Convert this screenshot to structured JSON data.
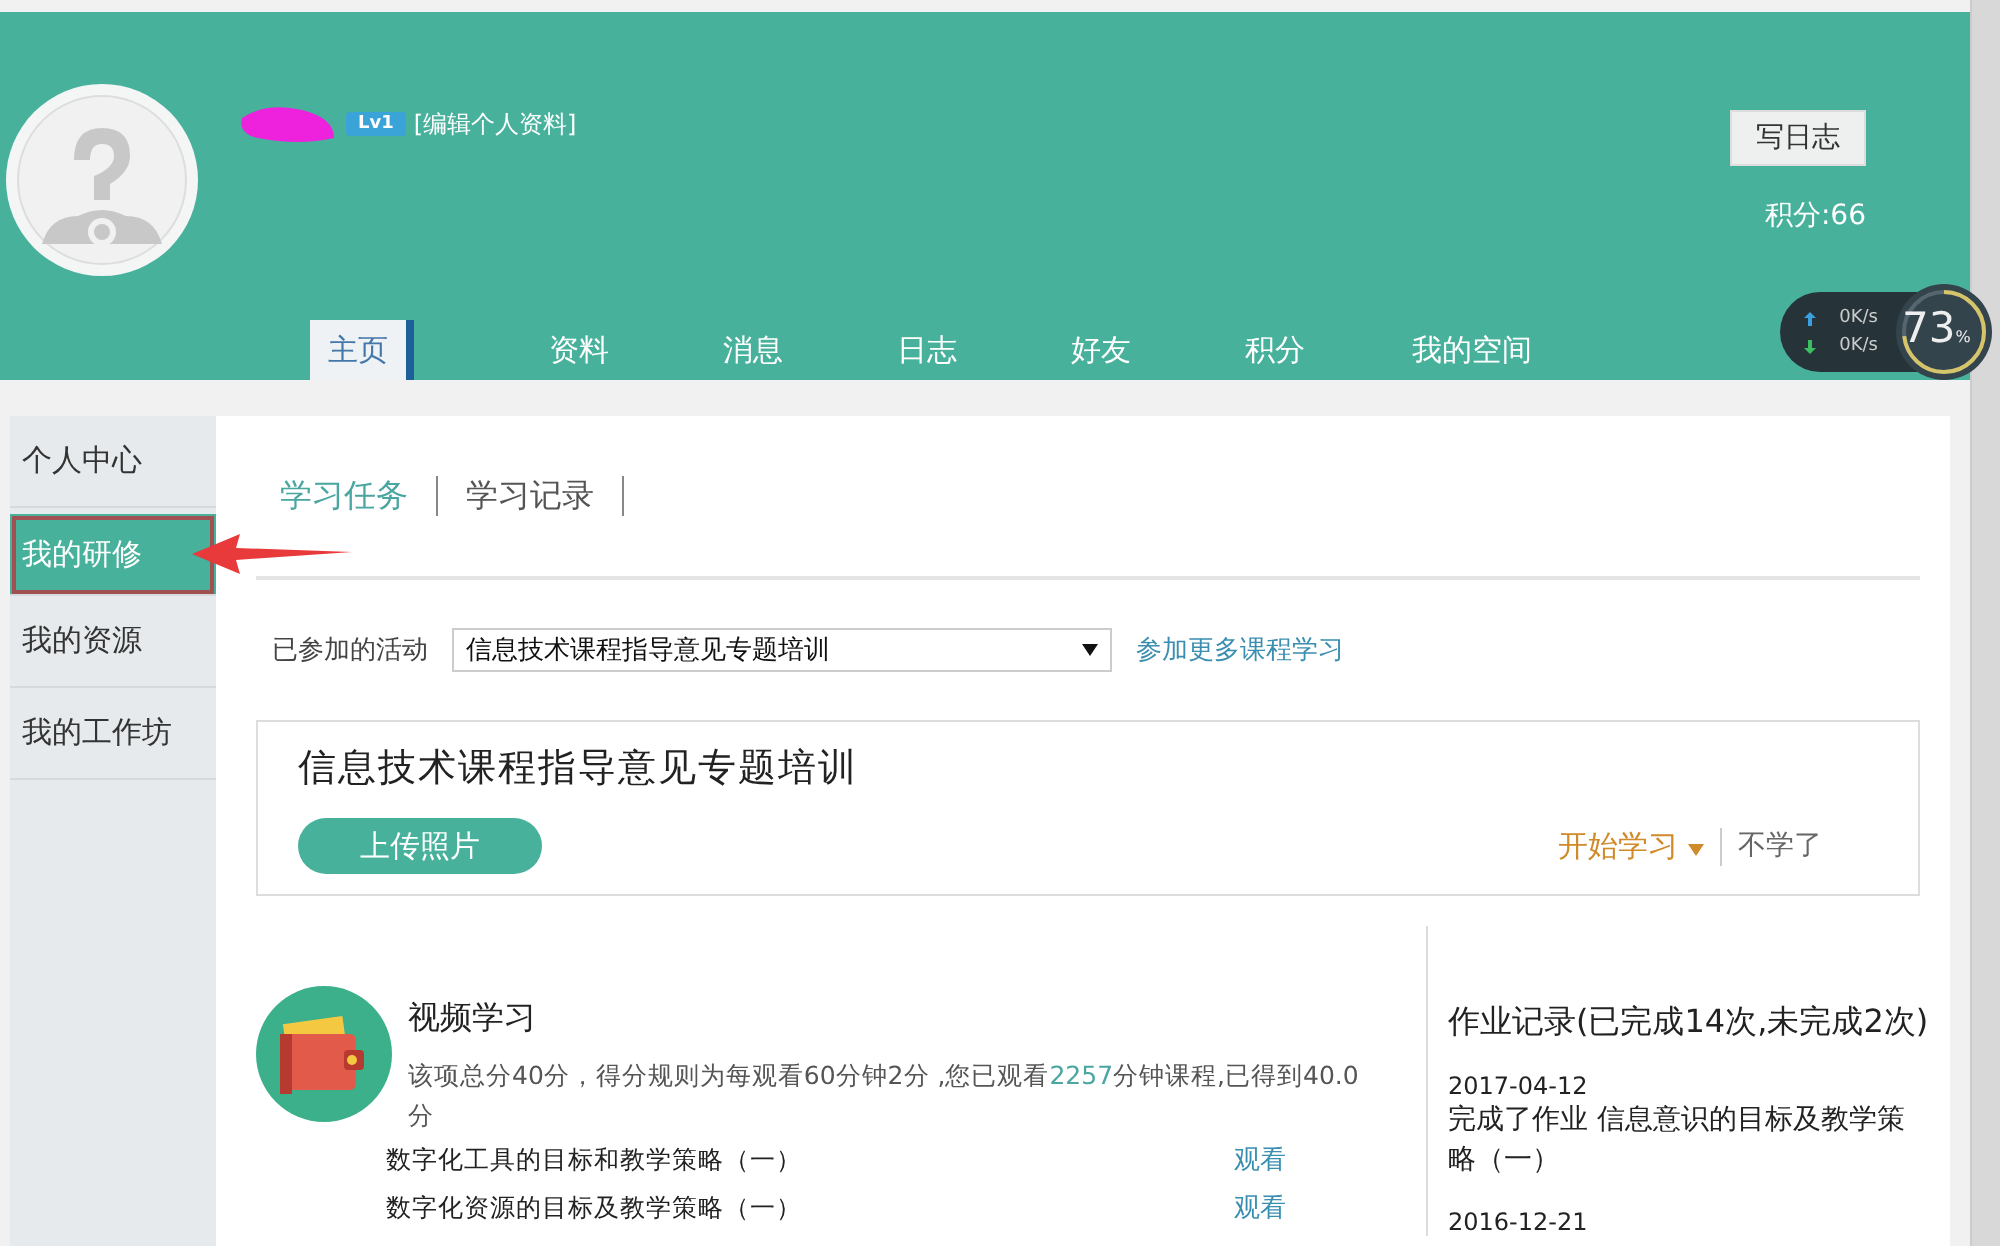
{
  "header": {
    "level_badge": "Lv1",
    "edit_link": "[编辑个人资料]",
    "write_button": "写日志",
    "points": "积分:66",
    "nav_tabs": [
      {
        "label": "主页",
        "selected": true
      },
      {
        "label": "资料",
        "selected": false
      },
      {
        "label": "消息",
        "selected": false
      },
      {
        "label": "日志",
        "selected": false
      },
      {
        "label": "好友",
        "selected": false
      },
      {
        "label": "积分",
        "selected": false
      },
      {
        "label": "我的空间",
        "selected": false
      }
    ]
  },
  "net_widget": {
    "upload": "0K/s",
    "download": "0K/s",
    "value": "73",
    "unit": "%"
  },
  "sidebar": {
    "items": [
      {
        "label": "个人中心",
        "selected": false
      },
      {
        "label": "我的研修",
        "selected": true
      },
      {
        "label": "我的资源",
        "selected": false
      },
      {
        "label": "我的工作坊",
        "selected": false
      }
    ]
  },
  "content_tabs": [
    {
      "label": "学习任务",
      "selected": true
    },
    {
      "label": "学习记录",
      "selected": false
    }
  ],
  "activity": {
    "label": "已参加的活动",
    "select_value": "信息技术课程指导意见专题培训",
    "link": "参加更多课程学习"
  },
  "course_card": {
    "title": "信息技术课程指导意见专题培训",
    "upload_button": "上传照片",
    "start_button": "开始学习",
    "quit_link": "不学了"
  },
  "video_study": {
    "title": "视频学习",
    "description": [
      "该项总分40分，得分规则为每观看60分钟2分 ,您已观看",
      "2257",
      "分钟课程,已得到40.0分"
    ],
    "lessons": [
      {
        "title": "数字化工具的目标和教学策略（一）",
        "action": "观看"
      },
      {
        "title": "数字化资源的目标及教学策略（一）",
        "action": "观看"
      }
    ]
  },
  "homework": {
    "title": "作业记录(已完成14次,未完成2次)",
    "entries": [
      {
        "date": "2017-04-12",
        "text": "完成了作业 信息意识的目标及教学策略（一）"
      },
      {
        "date": "2016-12-21"
      }
    ]
  }
}
